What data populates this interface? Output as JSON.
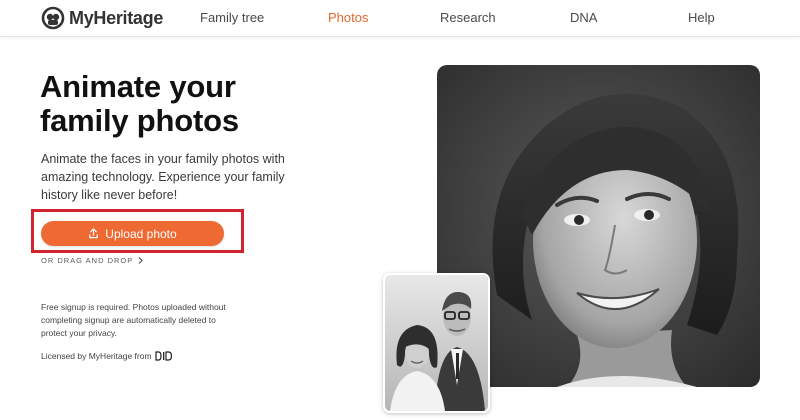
{
  "header": {
    "logo_text": "MyHeritage",
    "nav": [
      {
        "label": "Family tree",
        "active": false
      },
      {
        "label": "Photos",
        "active": true
      },
      {
        "label": "Research",
        "active": false
      },
      {
        "label": "DNA",
        "active": false
      },
      {
        "label": "Help",
        "active": false
      }
    ]
  },
  "hero": {
    "headline_line1": "Animate your",
    "headline_line2": "family photos",
    "description": "Animate the faces in your family photos with amazing technology. Experience your family history like never before!",
    "upload_label": "Upload photo",
    "drag_drop_label": "OR DRAG AND DROP",
    "signup_notice": "Free signup is required. Photos uploaded without completing signup are automatically deleted to protect your privacy.",
    "licensed_label": "Licensed by MyHeritage from",
    "licensed_logo": "D-ID"
  },
  "icons": {
    "logo": "myheritage-logo-icon",
    "upload": "upload-icon",
    "chevron": "chevron-right-icon"
  },
  "colors": {
    "accent": "#ef6a33",
    "nav_active": "#e8672d",
    "highlight": "#d3232f"
  }
}
